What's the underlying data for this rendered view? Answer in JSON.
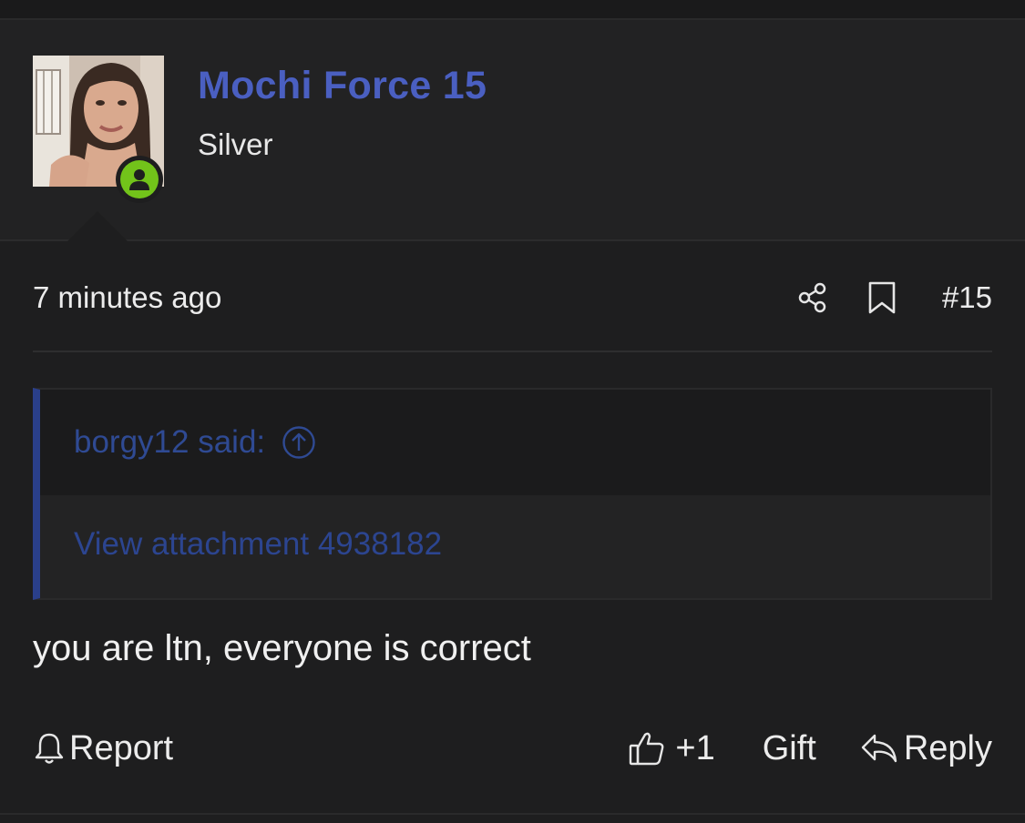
{
  "post": {
    "author": {
      "username": "Mochi Force 15",
      "rank": "Silver",
      "status": "online",
      "status_color": "#72c31a",
      "username_color": "#4a5fc1"
    },
    "timestamp": "7 minutes ago",
    "number": "#15",
    "quote": {
      "author_label": "borgy12 said:",
      "content": "View attachment 4938182",
      "accent_color": "#2a3f8a"
    },
    "body": "you are ltn, everyone is correct",
    "actions": {
      "report_label": "Report",
      "like_label": "+1",
      "gift_label": "Gift",
      "reply_label": "Reply"
    },
    "icons": {
      "share": "share-icon",
      "bookmark": "bookmark-icon",
      "quote_jump": "arrow-up-circle-icon",
      "report": "bell-icon",
      "like": "thumbs-up-icon",
      "reply": "reply-arrow-icon",
      "online": "user-icon"
    }
  }
}
